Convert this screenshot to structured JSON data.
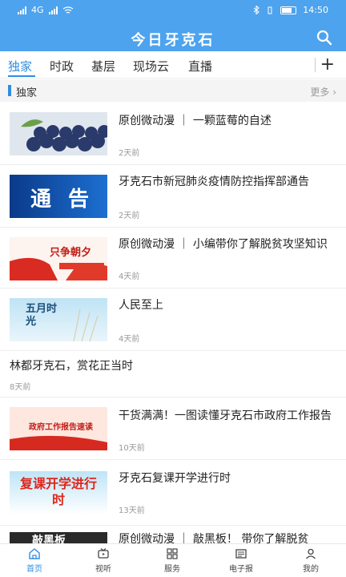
{
  "status_bar": {
    "network_left": "4G",
    "time": "14:50"
  },
  "header": {
    "app_title": "今日牙克石"
  },
  "tabs": [
    "独家",
    "时政",
    "基层",
    "现场云",
    "直播"
  ],
  "section": {
    "title": "独家",
    "more": "更多"
  },
  "news": [
    {
      "title": "原创微动漫 ｜ 一颗蓝莓的自述",
      "time": "2天前",
      "thumb_text": ""
    },
    {
      "title": "牙克石市新冠肺炎疫情防控指挥部通告",
      "time": "2天前",
      "thumb_text": "通 告"
    },
    {
      "title": "原创微动漫 ｜ 小编带你了解脱贫攻坚知识",
      "time": "4天前",
      "thumb_text": "只争朝夕"
    },
    {
      "title": "人民至上",
      "time": "4天前",
      "thumb_text": "五月时光"
    },
    {
      "title": "林都牙克石，赏花正当时",
      "time": "8天前",
      "thumb_text": ""
    },
    {
      "title": "干货满满！一图读懂牙克石市政府工作报告",
      "time": "10天前",
      "thumb_text": "政府工作报告速读"
    },
    {
      "title": "牙克石复课开学进行时",
      "time": "13天前",
      "thumb_text": "复课开学进行时"
    },
    {
      "title": "原创微动漫 ｜ 敲黑板！ 带你了解脱贫",
      "time": "",
      "thumb_text": "敲黑板"
    }
  ],
  "bottom_nav": [
    "首页",
    "视听",
    "服务",
    "电子报",
    "我的"
  ],
  "colors": {
    "brand": "#4da3ee",
    "accent": "#2f8de0"
  }
}
